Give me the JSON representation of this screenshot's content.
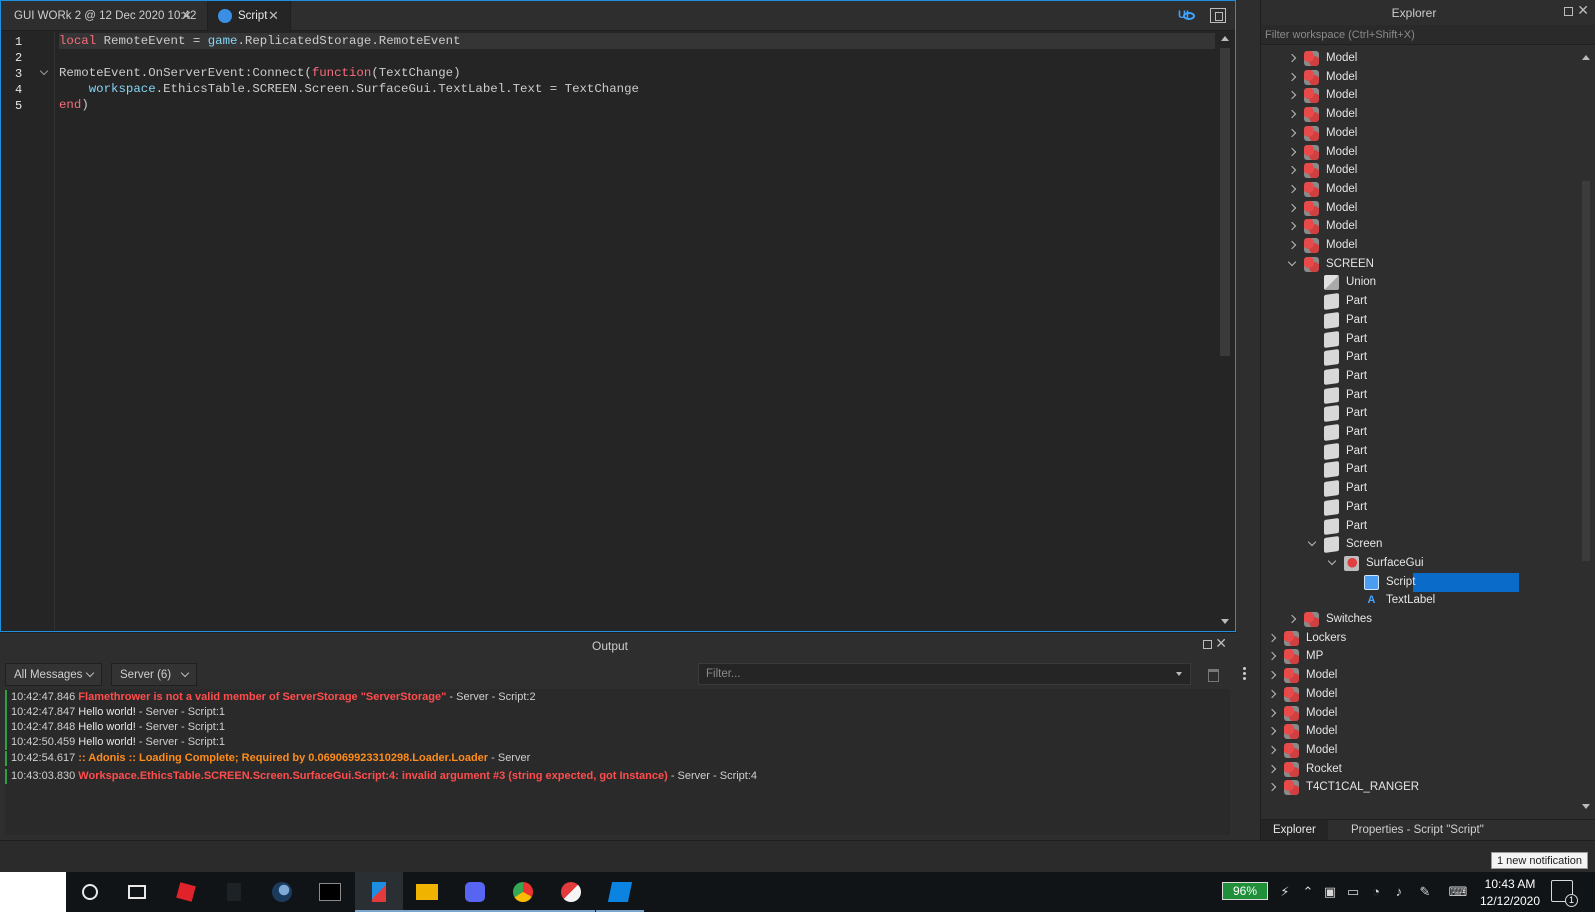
{
  "editor": {
    "tabs": [
      {
        "label": "GUI WORk 2 @ 12 Dec 2020 10:42"
      },
      {
        "label": "Script"
      }
    ],
    "ui_toggle": "UI",
    "line_numbers": [
      "1",
      "2",
      "3",
      "4",
      "5"
    ]
  },
  "output": {
    "title": "Output",
    "messages_filter": "All Messages",
    "context_filter": "Server (6)",
    "filter_placeholder": "Filter...",
    "lines": [
      {
        "time": "10:42:47.846",
        "message": "Flamethrower is not a valid member of ServerStorage \"ServerStorage\"",
        "source": " - Server - Script:2",
        "kind": "error"
      },
      {
        "time": "10:42:47.847",
        "message": "Hello world!",
        "source": " - Server - Script:1",
        "kind": "normal"
      },
      {
        "time": "10:42:47.848",
        "message": "Hello world!",
        "source": " - Server - Script:1",
        "kind": "normal"
      },
      {
        "time": "10:42:50.459",
        "message": "Hello world!",
        "source": " - Server - Script:1",
        "kind": "normal"
      },
      {
        "time": "10:42:54.617",
        "message": ":: Adonis :: Loading Complete; Required by 0.069069923310298.Loader.Loader",
        "source": " - Server",
        "kind": "warning"
      },
      {
        "time": "10:43:03.830",
        "message": "Workspace.EthicsTable.SCREEN.Screen.SurfaceGui.Script:4: invalid argument #3 (string expected, got Instance)",
        "source": " - Server - Script:4",
        "kind": "error"
      }
    ]
  },
  "explorer": {
    "title": "Explorer",
    "filter_placeholder": "Filter workspace (Ctrl+Shift+X)",
    "tree": [
      {
        "label": "Model",
        "icon": "model",
        "expander": "closed",
        "depth": 2
      },
      {
        "label": "Model",
        "icon": "model",
        "expander": "closed",
        "depth": 2
      },
      {
        "label": "Model",
        "icon": "model",
        "expander": "closed",
        "depth": 2
      },
      {
        "label": "Model",
        "icon": "model",
        "expander": "closed",
        "depth": 2
      },
      {
        "label": "Model",
        "icon": "model",
        "expander": "closed",
        "depth": 2
      },
      {
        "label": "Model",
        "icon": "model",
        "expander": "closed",
        "depth": 2
      },
      {
        "label": "Model",
        "icon": "model",
        "expander": "closed",
        "depth": 2
      },
      {
        "label": "Model",
        "icon": "model",
        "expander": "closed",
        "depth": 2
      },
      {
        "label": "Model",
        "icon": "model",
        "expander": "closed",
        "depth": 2
      },
      {
        "label": "Model",
        "icon": "model",
        "expander": "closed",
        "depth": 2
      },
      {
        "label": "Model",
        "icon": "model",
        "expander": "closed",
        "depth": 2
      },
      {
        "label": "SCREEN",
        "icon": "model",
        "expander": "open",
        "depth": 2
      },
      {
        "label": "Union",
        "icon": "union",
        "expander": "none",
        "depth": 3
      },
      {
        "label": "Part",
        "icon": "part",
        "expander": "none",
        "depth": 3
      },
      {
        "label": "Part",
        "icon": "part",
        "expander": "none",
        "depth": 3
      },
      {
        "label": "Part",
        "icon": "part",
        "expander": "none",
        "depth": 3
      },
      {
        "label": "Part",
        "icon": "part",
        "expander": "none",
        "depth": 3
      },
      {
        "label": "Part",
        "icon": "part",
        "expander": "none",
        "depth": 3
      },
      {
        "label": "Part",
        "icon": "part",
        "expander": "none",
        "depth": 3
      },
      {
        "label": "Part",
        "icon": "part",
        "expander": "none",
        "depth": 3
      },
      {
        "label": "Part",
        "icon": "part",
        "expander": "none",
        "depth": 3
      },
      {
        "label": "Part",
        "icon": "part",
        "expander": "none",
        "depth": 3
      },
      {
        "label": "Part",
        "icon": "part",
        "expander": "none",
        "depth": 3
      },
      {
        "label": "Part",
        "icon": "part",
        "expander": "none",
        "depth": 3
      },
      {
        "label": "Part",
        "icon": "part",
        "expander": "none",
        "depth": 3
      },
      {
        "label": "Part",
        "icon": "part",
        "expander": "none",
        "depth": 3
      },
      {
        "label": "Screen",
        "icon": "part",
        "expander": "open",
        "depth": 3
      },
      {
        "label": "SurfaceGui",
        "icon": "surfacegui",
        "expander": "open",
        "depth": 4
      },
      {
        "label": "Script",
        "icon": "script",
        "expander": "none",
        "depth": 5,
        "selected": true
      },
      {
        "label": "TextLabel",
        "icon": "textlabel",
        "expander": "none",
        "depth": 5
      },
      {
        "label": "Switches",
        "icon": "model",
        "expander": "closed",
        "depth": 2
      },
      {
        "label": "Lockers",
        "icon": "model",
        "expander": "closed",
        "depth": 1
      },
      {
        "label": "MP",
        "icon": "model",
        "expander": "closed",
        "depth": 1
      },
      {
        "label": "Model",
        "icon": "model",
        "expander": "closed",
        "depth": 1
      },
      {
        "label": "Model",
        "icon": "model",
        "expander": "closed",
        "depth": 1
      },
      {
        "label": "Model",
        "icon": "model",
        "expander": "closed",
        "depth": 1
      },
      {
        "label": "Model",
        "icon": "model",
        "expander": "closed",
        "depth": 1
      },
      {
        "label": "Model",
        "icon": "model",
        "expander": "closed",
        "depth": 1
      },
      {
        "label": "Rocket",
        "icon": "model",
        "expander": "closed",
        "depth": 1
      },
      {
        "label": "T4CT1CAL_RANGER",
        "icon": "model",
        "expander": "closed",
        "depth": 1
      }
    ],
    "bottom_tabs": [
      "Explorer",
      "Properties - Script \"Script\""
    ]
  },
  "notification": "1 new notification",
  "taskbar": {
    "battery": "96%",
    "time": "10:43 AM",
    "date": "12/12/2020",
    "notifications_count": "1",
    "apps": [
      "search-icon",
      "task-view-icon",
      "roblox-icon",
      "app-icon",
      "steam-icon",
      "terminal-icon",
      "roblox-studio-icon",
      "file-explorer-icon",
      "discord-icon",
      "chrome-icon",
      "ccleaner-icon",
      "roblox-studio-2-icon"
    ]
  },
  "colors": {
    "accent": "#1e8fe0",
    "keyword": "#f86d7c",
    "global": "#84d6f7",
    "error": "#ff4d4d",
    "warning": "#ff8c1a",
    "selection": "#0a6bc9"
  }
}
